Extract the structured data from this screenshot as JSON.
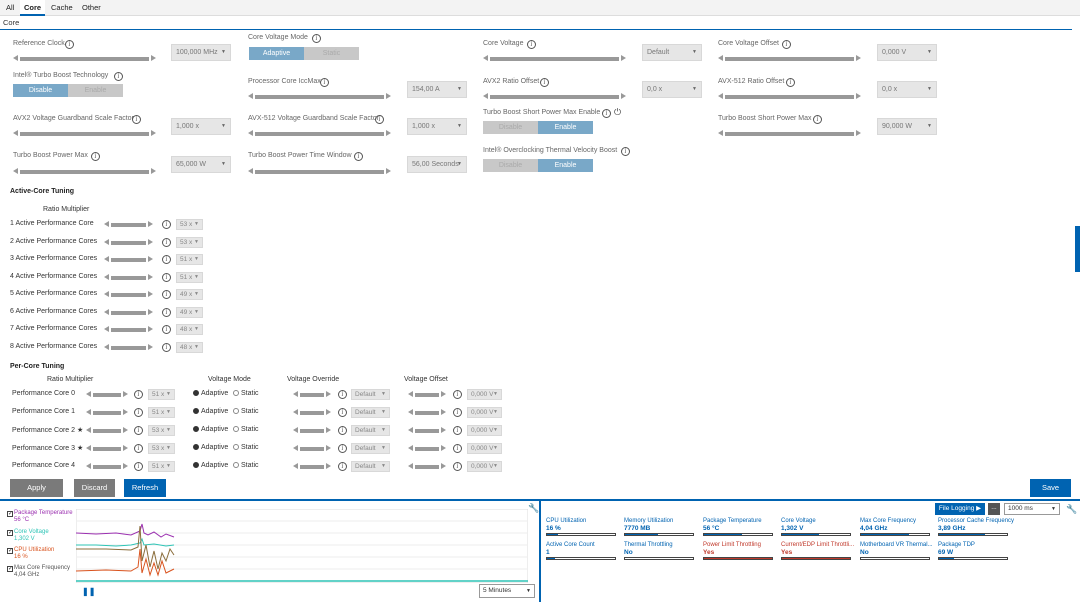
{
  "tabs": [
    "All",
    "Core",
    "Cache",
    "Other"
  ],
  "section_title": "Core",
  "settings": {
    "reference_clock": {
      "label": "Reference Clock",
      "value": "100,000 MHz"
    },
    "core_voltage_mode": {
      "label": "Core Voltage Mode",
      "options": [
        "Adaptive",
        "Static"
      ],
      "selected": "Adaptive"
    },
    "core_voltage": {
      "label": "Core Voltage",
      "value": "Default"
    },
    "core_voltage_offset": {
      "label": "Core Voltage Offset",
      "value": "0,000 V"
    },
    "turbo_boost_tech": {
      "label": "Intel® Turbo Boost Technology",
      "options": [
        "Disable",
        "Enable"
      ],
      "selected": "Disable"
    },
    "iccmax": {
      "label": "Processor Core IccMax",
      "value": "154,00 A"
    },
    "avx2_ratio_offset": {
      "label": "AVX2 Ratio Offset",
      "value": "0,0 x"
    },
    "avx512_ratio_offset": {
      "label": "AVX-512 Ratio Offset",
      "value": "0,0 x"
    },
    "avx2_guardband": {
      "label": "AVX2 Voltage Guardband Scale Factor",
      "value": "1,000 x"
    },
    "avx512_guardband": {
      "label": "AVX-512 Voltage Guardband Scale Factor",
      "value": "1,000 x"
    },
    "short_power_max_enable": {
      "label": "Turbo Boost Short Power Max Enable",
      "options": [
        "Disable",
        "Enable"
      ],
      "selected": "Enable"
    },
    "short_power_max": {
      "label": "Turbo Boost Short Power Max",
      "value": "90,000 W"
    },
    "power_max": {
      "label": "Turbo Boost Power Max",
      "value": "65,000 W"
    },
    "power_time_window": {
      "label": "Turbo Boost Power Time Window",
      "value": "56,00 Seconds"
    },
    "tvb": {
      "label": "Intel® Overclocking Thermal Velocity Boost",
      "options": [
        "Disable",
        "Enable"
      ],
      "selected": "Enable"
    }
  },
  "active_core_tuning": {
    "title": "Active-Core Tuning",
    "column": "Ratio Multiplier",
    "rows": [
      {
        "label": "1 Active Performance Core",
        "value": "53 x"
      },
      {
        "label": "2 Active Performance Cores",
        "value": "53 x"
      },
      {
        "label": "3 Active Performance Cores",
        "value": "51 x"
      },
      {
        "label": "4 Active Performance Cores",
        "value": "51 x"
      },
      {
        "label": "5 Active Performance Cores",
        "value": "49 x"
      },
      {
        "label": "6 Active Performance Cores",
        "value": "49 x"
      },
      {
        "label": "7 Active Performance Cores",
        "value": "48 x"
      },
      {
        "label": "8 Active Performance Cores",
        "value": "48 x"
      }
    ]
  },
  "per_core_tuning": {
    "title": "Per-Core Tuning",
    "columns": [
      "Ratio Multiplier",
      "Voltage Mode",
      "Voltage Override",
      "Voltage Offset"
    ],
    "radio_labels": [
      "Adaptive",
      "Static"
    ],
    "rows": [
      {
        "label": "Performance Core 0",
        "ratio": "51 x",
        "mode": "Adaptive",
        "override": "Default",
        "offset": "0,000 V"
      },
      {
        "label": "Performance Core 1",
        "ratio": "51 x",
        "mode": "Adaptive",
        "override": "Default",
        "offset": "0,000 V"
      },
      {
        "label": "Performance Core 2 ★",
        "ratio": "53 x",
        "mode": "Adaptive",
        "override": "Default",
        "offset": "0,000 V"
      },
      {
        "label": "Performance Core 3 ★",
        "ratio": "53 x",
        "mode": "Adaptive",
        "override": "Default",
        "offset": "0,000 V"
      },
      {
        "label": "Performance Core 4",
        "ratio": "51 x",
        "mode": "Adaptive",
        "override": "Default",
        "offset": "0,000 V"
      }
    ]
  },
  "buttons": {
    "apply": "Apply",
    "discard": "Discard",
    "refresh": "Refresh",
    "save": "Save"
  },
  "graph": {
    "legend": [
      {
        "name": "Package Temperature",
        "value": "56 °C",
        "color": "#9b30b0"
      },
      {
        "name": "Core Voltage",
        "value": "1,302 V",
        "color": "#2ec4b6"
      },
      {
        "name": "CPU Utilization",
        "value": "16 %",
        "color": "#d9531e"
      },
      {
        "name": "Max Core Frequency",
        "value": "4,04 GHz",
        "color": "#8a6d3b"
      }
    ],
    "time_range": "5 Minutes"
  },
  "monitor": {
    "file_logging": "File Logging ▶",
    "more": "...",
    "interval": "1000 ms",
    "metrics": [
      {
        "label": "CPU Utilization",
        "value": "16 %",
        "fill": 0.16,
        "warn": false
      },
      {
        "label": "Memory Utilization",
        "value": "7770  MB",
        "fill": 0.48,
        "warn": false
      },
      {
        "label": "Package Temperature",
        "value": "56 °C",
        "fill": 0.56,
        "warn": false
      },
      {
        "label": "Core Voltage",
        "value": "1,302 V",
        "fill": 0.55,
        "warn": false
      },
      {
        "label": "Max Core Frequency",
        "value": "4,04 GHz",
        "fill": 0.7,
        "warn": false
      },
      {
        "label": "Processor Cache Frequency",
        "value": "3,89 GHz",
        "fill": 0.68,
        "warn": false
      },
      {
        "label": "Active Core Count",
        "value": "1",
        "fill": 0.12,
        "warn": false
      },
      {
        "label": "Thermal Throttling",
        "value": "No",
        "fill": 0.0,
        "warn": false
      },
      {
        "label": "Power Limit Throttling",
        "value": "Yes",
        "fill": 1.0,
        "warn": true
      },
      {
        "label": "Current/EDP Limit Throttli...",
        "value": "Yes",
        "fill": 1.0,
        "warn": true
      },
      {
        "label": "Motherboard VR Thermal...",
        "value": "No",
        "fill": 0.0,
        "warn": false
      },
      {
        "label": "Package TDP",
        "value": "69 W",
        "fill": 0.22,
        "warn": false
      }
    ]
  }
}
